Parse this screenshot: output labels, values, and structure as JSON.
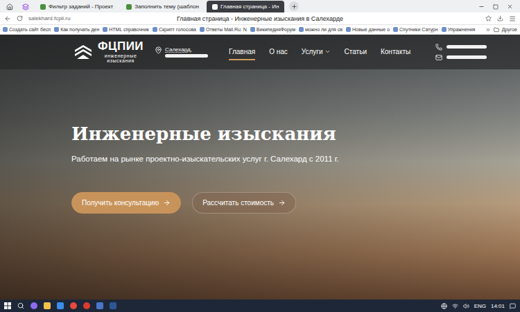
{
  "browser": {
    "tabs": [
      {
        "label": "Фильтр заданий - Проект",
        "selected": false
      },
      {
        "label": "Заполнить тему (шаблон",
        "selected": false
      },
      {
        "label": "Главная страница - Ин",
        "selected": true
      }
    ],
    "url": "salekhard.fcpii.ru",
    "page_title": "Главная страница - Инженерные изыскания в Салехарде",
    "bookmarks": [
      "Создать сайт бесп",
      "Как получать ден",
      "HTML справочник",
      "Скрипт голосова",
      "Ответы Mail.Ru: N",
      "ВикипедияФорум",
      "можно ли для св",
      "Новые данные о",
      "Спутники Сатурн",
      "Упражнения"
    ],
    "other_bookmarks": "Другое"
  },
  "site": {
    "logo": {
      "name": "ФЦПИИ",
      "tagline": [
        "инженерные",
        "изыскания"
      ]
    },
    "location": "Салехард,",
    "nav": [
      {
        "label": "Главная",
        "selected": true,
        "dropdown": false
      },
      {
        "label": "О нас",
        "selected": false,
        "dropdown": false
      },
      {
        "label": "Услуги",
        "selected": false,
        "dropdown": true
      },
      {
        "label": "Статьи",
        "selected": false,
        "dropdown": false
      },
      {
        "label": "Контакты",
        "selected": false,
        "dropdown": false
      }
    ],
    "hero": {
      "title": "Инженерные изыскания",
      "subtitle": "Работаем на рынке проектно-изыскательских услуг г. Салехард с 2011 г.",
      "buttons": [
        {
          "label": "Получить консультацию",
          "kind": "primary"
        },
        {
          "label": "Рассчитать стоимость",
          "kind": "secondary"
        }
      ]
    }
  },
  "taskbar": {
    "language": "ENG",
    "time": "14:01"
  }
}
